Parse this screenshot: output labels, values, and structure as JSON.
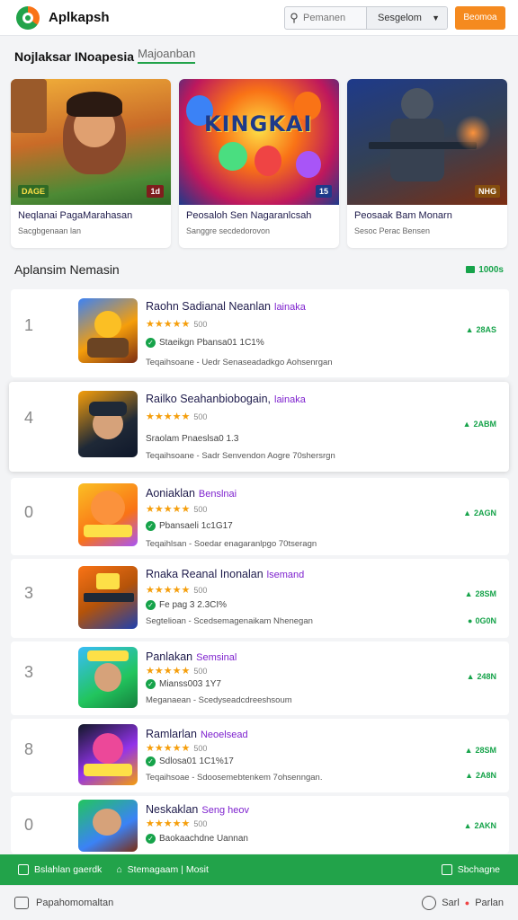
{
  "header": {
    "app_title": "Aplkapsh",
    "search_placeholder": "Pemanen",
    "select_label": "Sesgelom",
    "action_label": "Beomoa"
  },
  "tabs": {
    "main": "Nojlaksar INoapesia",
    "sub": "Majoanban"
  },
  "featured": [
    {
      "title": "Neqlanai PagaMarahasan",
      "subtitle": "Sacgbgenaan lan",
      "badge_left": "DAGE",
      "badge_right": "1d"
    },
    {
      "title": "Peosaloh Sen Nagaranlcsah",
      "subtitle": "Sanggre secdedorovon",
      "badge_left": "",
      "badge_right": "15",
      "art_title": "KINGKAI"
    },
    {
      "title": "Peosaak Bam Monarn",
      "subtitle": "Sesoc Perac Bensen",
      "badge_left": "",
      "badge_right": "NHG"
    }
  ],
  "section": {
    "title": "Aplansim Nemasin",
    "link": "1000s"
  },
  "apps": [
    {
      "rank": "1",
      "title": "Raohn Sadianal Neanlan",
      "accent": "lainaka",
      "stars": "★★★★★",
      "count": "500",
      "meta": "Staeikgn   Pbansa01 1C1%",
      "desc": "Teqaihsoane - Uedr Senaseadadkgo Aohsenrgan",
      "download": "28AS"
    },
    {
      "rank": "4",
      "title": "Railko Seahanbiobogain,",
      "accent": "lainaka",
      "stars": "★★★★★",
      "count": "500",
      "meta": "Sraolam   Pnaeslsa0 1.3",
      "desc": "Teqaihsoane - Sadr Senvendon Aogre 70shersrgn",
      "download": "2ABM"
    },
    {
      "rank": "0",
      "title": "Aoniaklan",
      "accent": "Benslnai",
      "stars": "★★★★★",
      "count": "500",
      "meta": "Pbansaeli 1c1G17",
      "desc": "Teqaihlsan - Soedar enagaranlpgo 70tseragn",
      "download": "2AGN"
    },
    {
      "rank": "3",
      "title": "Rnaka Reanal Inonalan",
      "accent": "lsemand",
      "stars": "★★★★★",
      "count": "500",
      "meta": "Fe pag 3  2.3CI%",
      "desc": "Segtelioan - Scedsemagenaikam Nhenegan",
      "download": "28SM",
      "download2": "0G0N"
    },
    {
      "rank": "3",
      "title": "Panlakan",
      "accent": "Semsinal",
      "stars": "★★★★★",
      "count": "500",
      "meta": "Mianss003 1Y7",
      "desc": "Meganaean - Scedyseadcdreeshsoum",
      "download": "248N"
    },
    {
      "rank": "8",
      "title": "Ramlarlan",
      "accent": "Neoelsead",
      "stars": "★★★★★",
      "count": "500",
      "meta": "Sdlosa01 1C1%17",
      "desc": "Teqaihsoae - Sdoosemebtenkem 7ohsenngan.",
      "download": "28SM",
      "download2": "2A8N"
    },
    {
      "rank": "0",
      "title": "Neskaklan",
      "accent": "Seng heov",
      "stars": "★★★★★",
      "count": "500",
      "meta": "Baokaachdne Uannan",
      "desc": "",
      "download": "2AKN"
    }
  ],
  "greenbar": {
    "left": "Bslahlan gaerdk",
    "middle": "Stemagaam | Mosit",
    "right": "Sbchagne"
  },
  "footer": {
    "left": "Papahomomaltan",
    "right_a": "Sarl",
    "right_b": "Parlan"
  },
  "colors": {
    "accent_green": "#22a34a",
    "accent_orange": "#f58a1f",
    "title_navy": "#1e1b4b",
    "accent_purple": "#7e22ce"
  }
}
